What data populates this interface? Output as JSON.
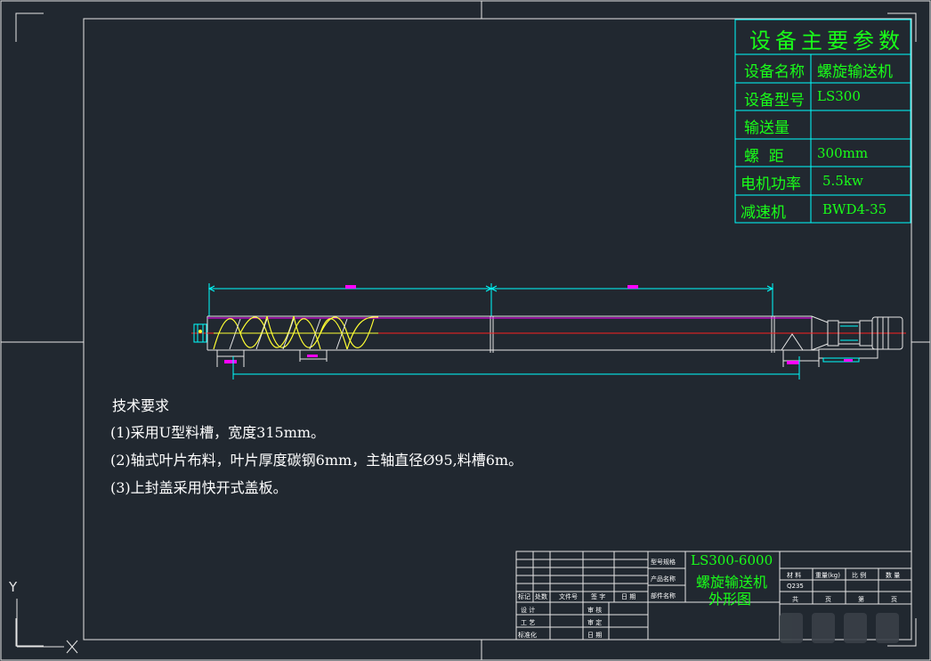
{
  "params": {
    "header": "设备主要参数",
    "rows": [
      {
        "label": "设备名称",
        "value": "螺旋输送机"
      },
      {
        "label": "设备型号",
        "value": "LS300"
      },
      {
        "label": "输送量",
        "value": ""
      },
      {
        "label": "螺  距",
        "value": "300mm"
      },
      {
        "label": "电机功率",
        "value": "5.5kw"
      },
      {
        "label": "减速机",
        "value": "BWD4-35"
      }
    ]
  },
  "tech": {
    "title": "技术要求",
    "items": [
      "(1)采用U型料槽，宽度315mm。",
      "(2)轴式叶片布料，叶片厚度碳钢6mm，主轴直径Ø95,料槽6m。",
      "(3)上封盖采用快开式盖板。"
    ]
  },
  "title_block": {
    "model_label": "型号规格",
    "model": "LS300-6000",
    "product_label": "产品名称",
    "product": "螺旋输送机",
    "part_label": "部件名称",
    "part": "外形图",
    "rev_headers": [
      "标记",
      "处数",
      "文件号",
      "签 字",
      "日 期"
    ],
    "sign_rows": [
      {
        "left": "设 计",
        "right": "审 核"
      },
      {
        "left": "工 艺",
        "right": "审 定"
      },
      {
        "left": "标准化",
        "right": "日 期"
      }
    ],
    "mat_headers": [
      "材 料",
      "重量(kg)",
      "比 例",
      "数 量"
    ],
    "material": "Q235",
    "sheet_labels": [
      "共",
      "页",
      "第",
      "页"
    ]
  },
  "axis": {
    "y": "Y",
    "x": "X"
  },
  "colors": {
    "background": "#212830",
    "frame": "#e6e6e6",
    "param_grid": "#00ffff",
    "green": "#19ff19",
    "magenta": "#ff00ff",
    "red": "#ff2020",
    "yellow": "#ffff33"
  }
}
